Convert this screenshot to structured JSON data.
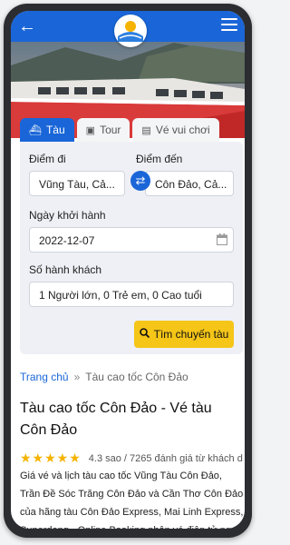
{
  "tabs": [
    {
      "label": "Tàu",
      "icon": "ship-icon"
    },
    {
      "label": "Tour",
      "icon": "suitcase-icon"
    },
    {
      "label": "Vé vui chơi",
      "icon": "ticket-icon"
    }
  ],
  "form": {
    "from_label": "Điểm đi",
    "from_value": "Vũng Tàu, Cả...",
    "to_label": "Điểm đến",
    "to_value": "Côn Đảo, Cả...",
    "date_label": "Ngày khởi hành",
    "date_value": "2022-12-07",
    "passengers_label": "Số hành khách",
    "passengers_value": "1 Người lớn, 0 Trẻ em, 0 Cao tuổi",
    "search_label": "Tìm chuyến tàu"
  },
  "breadcrumb": {
    "home": "Trang chủ",
    "separator": "»",
    "current": "Tàu cao tốc Côn Đảo"
  },
  "page_title": "Tàu cao tốc Côn Đảo - Vé tàu Côn Đảo",
  "rating": {
    "stars": "★★★★★",
    "text": "4.3 sao / 7265 đánh giá từ khách d..."
  },
  "description": "Giá vé và lịch tàu cao tốc Vũng Tàu Côn Đảo, Trần Đề Sóc Trăng Côn Đảo và Cần Thơ Côn Đảo của hãng tàu Côn Đảo Express, Mai Linh Express, Superdong - Online Booking nhận vé điện tử ngay",
  "colors": {
    "primary": "#1a66d8",
    "accent": "#f5c518",
    "star": "#f5b300"
  }
}
